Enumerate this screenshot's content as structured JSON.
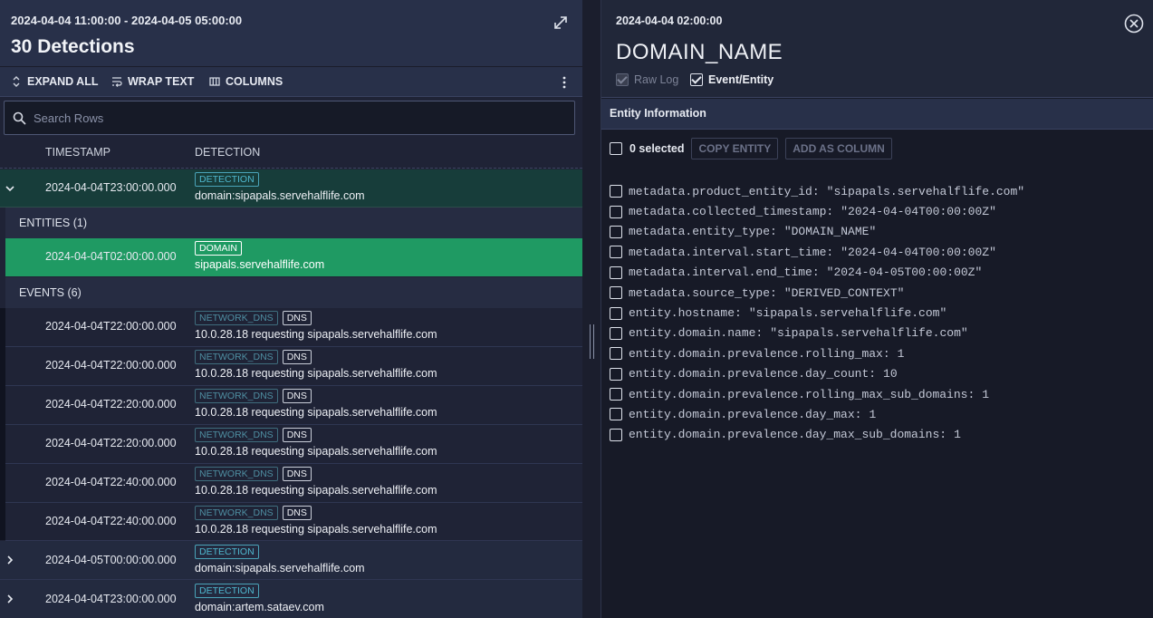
{
  "left": {
    "time_range": "2024-04-04 11:00:00 - 2024-04-05 05:00:00",
    "title": "30 Detections",
    "toolbar": {
      "expand_all": "EXPAND ALL",
      "wrap_text": "WRAP TEXT",
      "columns": "COLUMNS"
    },
    "search_placeholder": "Search Rows",
    "columns": [
      "TIMESTAMP",
      "DETECTION"
    ],
    "rows": [
      {
        "ts": "2024-04-04T23:00:00.000",
        "tag": "DETECTION",
        "text": "domain:sipapals.servehalflife.com",
        "expanded": true
      },
      {
        "ts": "2024-04-05T00:00:00.000",
        "tag": "DETECTION",
        "text": "domain:sipapals.servehalflife.com",
        "expanded": false
      },
      {
        "ts": "2024-04-04T23:00:00.000",
        "tag": "DETECTION",
        "text": "domain:artem.sataev.com",
        "expanded": false
      }
    ],
    "entities_label": "ENTITIES (1)",
    "entity": {
      "ts": "2024-04-04T02:00:00.000",
      "tag": "DOMAIN",
      "text": "sipapals.servehalflife.com"
    },
    "events_label": "EVENTS (6)",
    "events": [
      {
        "ts": "2024-04-04T22:00:00.000",
        "tags": [
          "NETWORK_DNS",
          "DNS"
        ],
        "text": "10.0.28.18 requesting sipapals.servehalflife.com"
      },
      {
        "ts": "2024-04-04T22:00:00.000",
        "tags": [
          "NETWORK_DNS",
          "DNS"
        ],
        "text": "10.0.28.18 requesting sipapals.servehalflife.com"
      },
      {
        "ts": "2024-04-04T22:20:00.000",
        "tags": [
          "NETWORK_DNS",
          "DNS"
        ],
        "text": "10.0.28.18 requesting sipapals.servehalflife.com"
      },
      {
        "ts": "2024-04-04T22:20:00.000",
        "tags": [
          "NETWORK_DNS",
          "DNS"
        ],
        "text": "10.0.28.18 requesting sipapals.servehalflife.com"
      },
      {
        "ts": "2024-04-04T22:40:00.000",
        "tags": [
          "NETWORK_DNS",
          "DNS"
        ],
        "text": "10.0.28.18 requesting sipapals.servehalflife.com"
      },
      {
        "ts": "2024-04-04T22:40:00.000",
        "tags": [
          "NETWORK_DNS",
          "DNS"
        ],
        "text": "10.0.28.18 requesting sipapals.servehalflife.com"
      }
    ]
  },
  "right": {
    "timestamp": "2024-04-04 02:00:00",
    "title": "DOMAIN_NAME",
    "raw_log_label": "Raw Log",
    "event_entity_label": "Event/Entity",
    "section_title": "Entity Information",
    "selected_count": "0 selected",
    "copy_entity": "COPY ENTITY",
    "add_as_column": "ADD AS COLUMN",
    "fields": [
      {
        "key": "metadata.product_entity_id:",
        "value": "\"sipapals.servehalflife.com\""
      },
      {
        "key": "metadata.collected_timestamp:",
        "value": "\"2024-04-04T00:00:00Z\""
      },
      {
        "key": "metadata.entity_type:",
        "value": "\"DOMAIN_NAME\""
      },
      {
        "key": "metadata.interval.start_time:",
        "value": "\"2024-04-04T00:00:00Z\""
      },
      {
        "key": "metadata.interval.end_time:",
        "value": "\"2024-04-05T00:00:00Z\""
      },
      {
        "key": "metadata.source_type:",
        "value": "\"DERIVED_CONTEXT\""
      },
      {
        "key": "entity.hostname:",
        "value": "\"sipapals.servehalflife.com\""
      },
      {
        "key": "entity.domain.name:",
        "value": "\"sipapals.servehalflife.com\""
      },
      {
        "key": "entity.domain.prevalence.rolling_max:",
        "value": "1"
      },
      {
        "key": "entity.domain.prevalence.day_count:",
        "value": "10"
      },
      {
        "key": "entity.domain.prevalence.rolling_max_sub_domains:",
        "value": "1"
      },
      {
        "key": "entity.domain.prevalence.day_max:",
        "value": "1"
      },
      {
        "key": "entity.domain.prevalence.day_max_sub_domains:",
        "value": "1"
      }
    ]
  },
  "colors": {
    "accent_green": "#1f9a63",
    "expanded_row": "#173d3a",
    "detection_tag": "#4fb8cf"
  },
  "icons": [
    "expand-diagonal-icon",
    "chevron-updown-icon",
    "wrap-text-icon",
    "columns-icon",
    "kebab-menu-icon",
    "search-icon",
    "chevron-down-icon",
    "chevron-right-icon",
    "close-circle-icon",
    "checkbox-icon"
  ]
}
